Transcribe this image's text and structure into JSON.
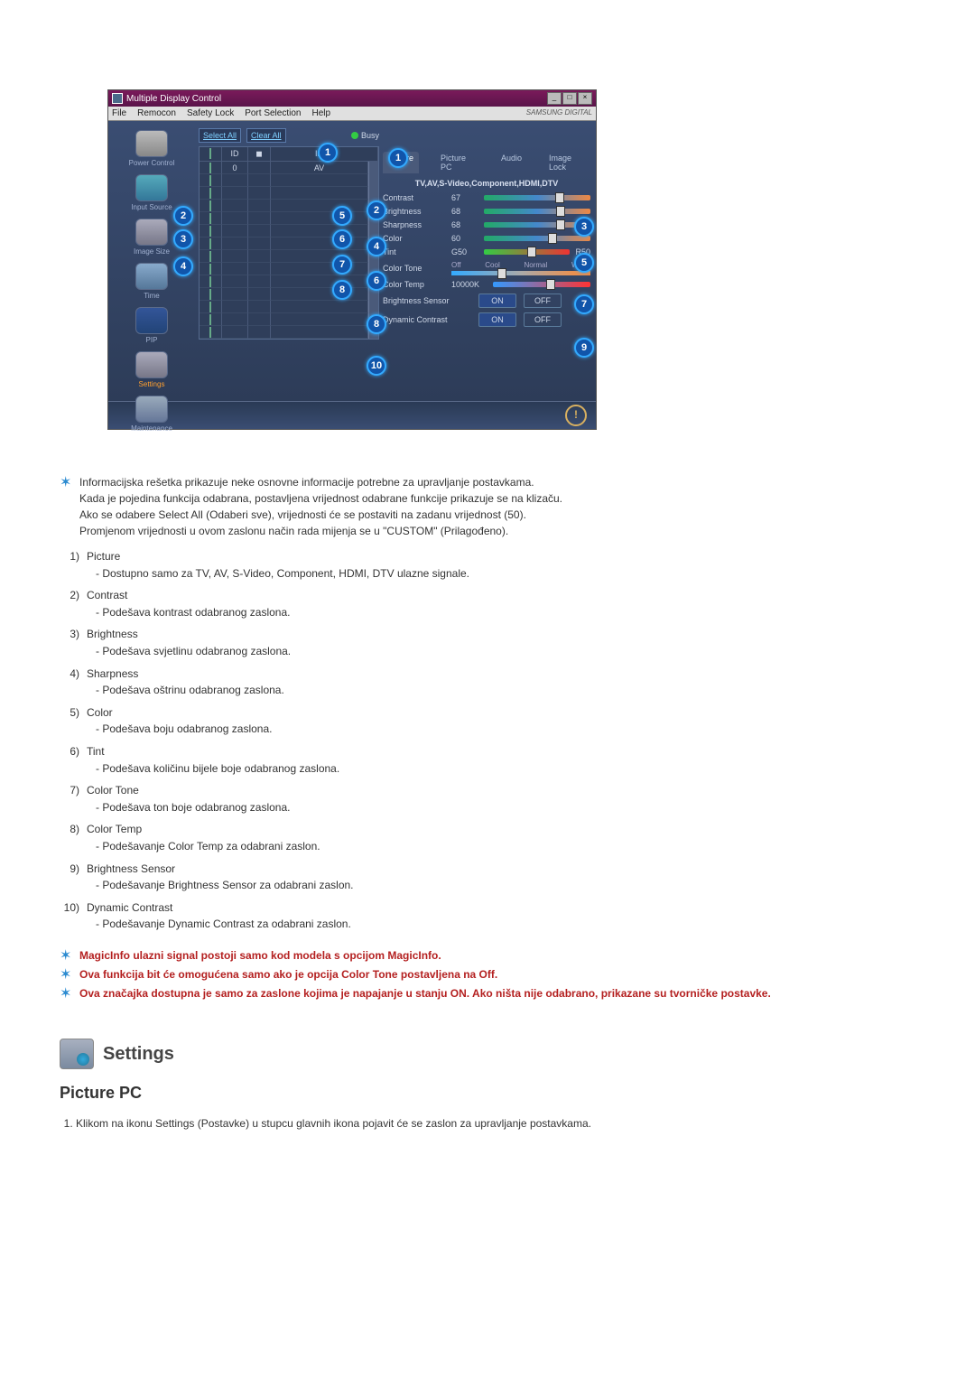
{
  "app": {
    "title": "Multiple Display Control",
    "menu": [
      "File",
      "Remocon",
      "Safety Lock",
      "Port Selection",
      "Help"
    ],
    "brand": "SAMSUNG DIGITAL",
    "nav": [
      {
        "label": "Power Control"
      },
      {
        "label": "Input Source"
      },
      {
        "label": "Image Size"
      },
      {
        "label": "Time"
      },
      {
        "label": "PIP"
      },
      {
        "label": "Settings"
      },
      {
        "label": "Maintenance"
      }
    ],
    "actions": {
      "select_all": "Select All",
      "clear_all": "Clear All",
      "busy": "Busy"
    },
    "grid": {
      "cols": [
        "",
        "ID",
        "",
        "Input"
      ],
      "row0": {
        "id": "0",
        "input": "AV"
      }
    },
    "tabs": [
      "Picture",
      "Picture PC",
      "Audio",
      "Image Lock"
    ],
    "subtitle": "TV,AV,S-Video,Component,HDMI,DTV",
    "rows": {
      "contrast": {
        "label": "Contrast",
        "val": "67"
      },
      "brightness": {
        "label": "Brightness",
        "val": "68"
      },
      "sharpness": {
        "label": "Sharpness",
        "val": "68"
      },
      "color": {
        "label": "Color",
        "val": "60"
      },
      "tint": {
        "label": "Tint",
        "left": "G50",
        "right": "R50"
      },
      "tone": {
        "label": "Color Tone",
        "opts": [
          "Off",
          "Cool",
          "Normal",
          "Warm"
        ]
      },
      "temp": {
        "label": "Color Temp",
        "val": "10000K"
      },
      "bsensor": {
        "label": "Brightness Sensor"
      },
      "dyn": {
        "label": "Dynamic Contrast"
      },
      "on": "ON",
      "off": "OFF"
    }
  },
  "doc": {
    "stars": [
      "Informacijska rešetka prikazuje neke osnovne informacije potrebne za upravljanje postavkama.",
      "Kada je pojedina funkcija odabrana, postavljena vrijednost odabrane funkcije prikazuje se na klizaču.",
      "Ako se odabere Select All (Odaberi sve), vrijednosti će se postaviti na zadanu vrijednost (50).",
      "Promjenom vrijednosti u ovom zaslonu način rada mijenja se u \"CUSTOM\" (Prilagođeno)."
    ],
    "items": [
      {
        "n": "1)",
        "t": "Picture",
        "d": "- Dostupno samo za TV, AV, S-Video, Component, HDMI, DTV ulazne signale."
      },
      {
        "n": "2)",
        "t": "Contrast",
        "d": "- Podešava kontrast odabranog zaslona."
      },
      {
        "n": "3)",
        "t": "Brightness",
        "d": "- Podešava svjetlinu odabranog zaslona."
      },
      {
        "n": "4)",
        "t": "Sharpness",
        "d": "- Podešava oštrinu odabranog zaslona."
      },
      {
        "n": "5)",
        "t": "Color",
        "d": "- Podešava boju odabranog zaslona."
      },
      {
        "n": "6)",
        "t": "Tint",
        "d": "- Podešava količinu bijele boje odabranog zaslona."
      },
      {
        "n": "7)",
        "t": "Color Tone",
        "d": "- Podešava ton boje odabranog zaslona."
      },
      {
        "n": "8)",
        "t": "Color Temp",
        "d": "- Podešavanje Color Temp za odabrani zaslon."
      },
      {
        "n": "9)",
        "t": "Brightness Sensor",
        "d": "- Podešavanje Brightness Sensor za odabrani zaslon."
      },
      {
        "n": "10)",
        "t": "Dynamic Contrast",
        "d": "- Podešavanje Dynamic Contrast za odabrani zaslon."
      }
    ],
    "notes": [
      "MagicInfo ulazni signal postoji samo kod modela s opcijom MagicInfo.",
      "Ova funkcija bit će omogućena samo ako je opcija Color Tone postavljena na Off.",
      "Ova značajka dostupna je samo za zaslone kojima je napajanje u stanju ON. Ako ništa nije odabrano, prikazane su tvorničke postavke."
    ],
    "section_title": "Settings",
    "sub_title": "Picture PC",
    "final_1": "Klikom na ikonu Settings (Postavke) u stupcu glavnih ikona pojavit će se zaslon za upravljanje postavkama."
  }
}
